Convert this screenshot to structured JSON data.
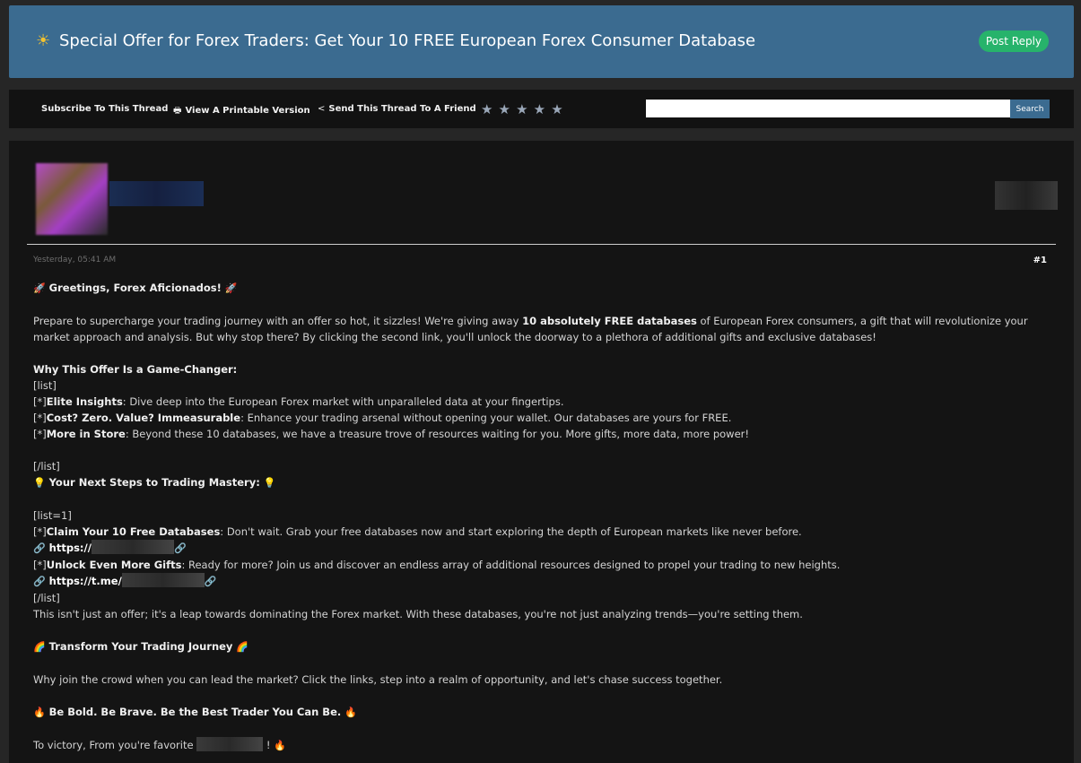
{
  "header": {
    "title": "Special Offer for Forex Traders: Get Your 10 FREE European Forex Consumer Database",
    "title_icon": "☀",
    "post_reply_label": "Post Reply"
  },
  "toolbar": {
    "subscribe_label": "Subscribe To This Thread",
    "printable_label": "View A Printable Version",
    "send_label": "Send This Thread To A Friend",
    "search_button_label": "Search",
    "search_value": "",
    "rating_stars": 5
  },
  "post": {
    "date": "Yesterday, 05:41 AM",
    "number": "#1",
    "greeting": "Greetings, Forex Aficionados!",
    "intro_1": "Prepare to supercharge your trading journey with an offer so hot, it sizzles! We're giving away ",
    "intro_bold": "10 absolutely FREE databases",
    "intro_2": " of European Forex consumers, a gift that will revolutionize your market approach and analysis. But why stop there? By clicking the second link, you'll unlock the doorway to a plethora of additional gifts and exclusive databases!",
    "why_heading": "Why This Offer Is a Game-Changer:",
    "list_open": "[list]",
    "item_prefix": "[*]",
    "item1_bold": "Elite Insights",
    "item1_text": ": Dive deep into the European Forex market with unparalleled data at your fingertips.",
    "item2_bold": "Cost? Zero. Value? Immeasurable",
    "item2_text": ": Enhance your trading arsenal without opening your wallet. Our databases are yours for FREE.",
    "item3_bold": "More in Store",
    "item3_text": ": Beyond these 10 databases, we have a treasure trove of resources waiting for you. More gifts, more data, more power!",
    "list_close": "[/list]",
    "next_steps_heading": "Your Next Steps to Trading Mastery:",
    "list1_open": "[list=1]",
    "step1_bold": "Claim Your 10 Free Databases",
    "step1_text": ": Don't wait. Grab your free databases now and start exploring the depth of European markets like never before.",
    "link1": "https://",
    "step2_bold": "Unlock Even More Gifts",
    "step2_text": ": Ready for more? Join us and discover an endless array of additional resources designed to propel your trading to new heights.",
    "link2": "https://t.me/",
    "offer_text": "This isn't just an offer; it's a leap towards dominating the Forex market. With these databases, you're not just analyzing trends—you're setting them.",
    "transform_heading": "Transform Your Trading Journey",
    "why_join_text": "Why join the crowd when you can lead the market? Click the links, step into a realm of opportunity, and let's chase success together.",
    "bold_brave": "Be Bold. Be Brave. Be the Best Trader You Can Be.",
    "closing_text": "To victory, From you're favorite",
    "closing_end": "!"
  },
  "icons": {
    "rocket": "🚀",
    "bulb": "💡",
    "link": "🔗",
    "rainbow": "🌈",
    "fire": "🔥",
    "printer": "🖶",
    "share": "<",
    "star": "★"
  },
  "colors": {
    "header_bg": "#3b6b90",
    "post_reply_bg": "#27b36b",
    "page_bg": "#262626",
    "panel_bg": "#141414",
    "star": "#9aa7b8"
  }
}
